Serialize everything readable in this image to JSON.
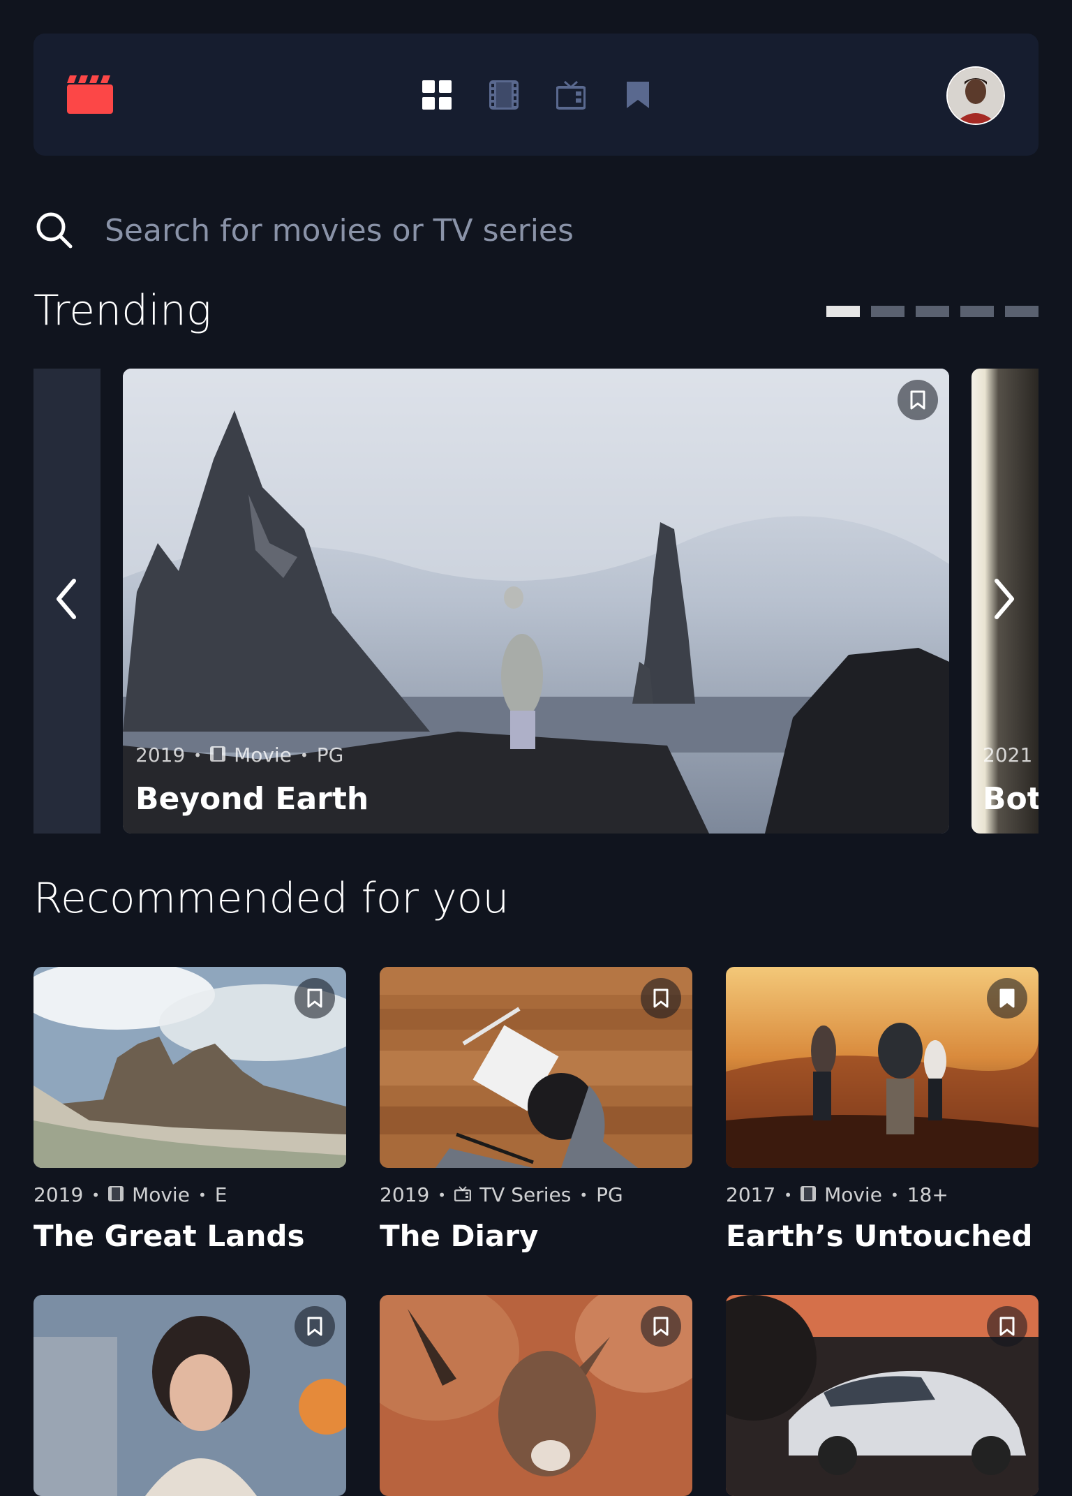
{
  "nav": {
    "items": [
      {
        "name": "home",
        "icon": "grid-icon",
        "active": true
      },
      {
        "name": "movies",
        "icon": "film-icon"
      },
      {
        "name": "tv-series",
        "icon": "tv-icon"
      },
      {
        "name": "bookmarks",
        "icon": "bookmark-icon"
      }
    ]
  },
  "search": {
    "placeholder": "Search for movies or TV series"
  },
  "trending": {
    "title": "Trending",
    "dots_total": 5,
    "active_dot": 1,
    "items": [
      {
        "year": "2019",
        "category": "Movie",
        "rating": "PG",
        "title": "Beyond Earth"
      },
      {
        "year": "2021",
        "title": "Bot"
      }
    ]
  },
  "recommended": {
    "title": "Recommended for you",
    "items": [
      {
        "year": "2019",
        "category": "Movie",
        "rating": "E",
        "title": "The Great Lands"
      },
      {
        "year": "2019",
        "category": "TV Series",
        "rating": "PG",
        "title": "The Diary"
      },
      {
        "year": "2017",
        "category": "Movie",
        "rating": "18+",
        "title": "Earth’s Untouched"
      }
    ]
  },
  "colors": {
    "background": "#10141e",
    "surface": "#161d2f",
    "accent": "#fc4747",
    "muted": "#5a698f"
  }
}
